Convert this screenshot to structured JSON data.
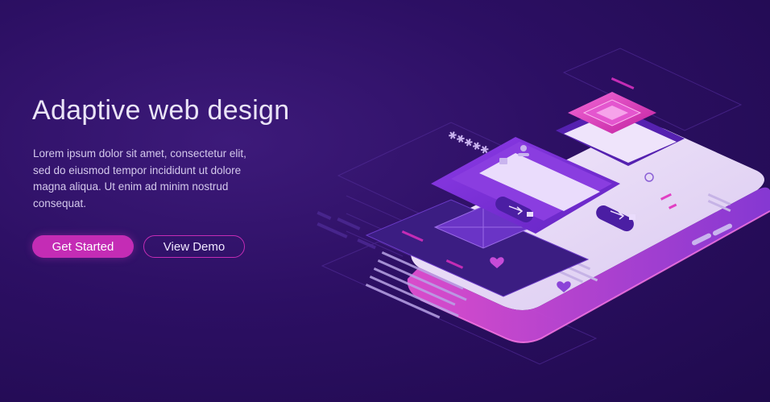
{
  "hero": {
    "title": "Adaptive web design",
    "body": "Lorem ipsum dolor sit amet, consectetur elit, sed do eiusmod tempor incididunt ut dolore magna aliqua. Ut enim ad minim nostrud consequat."
  },
  "buttons": {
    "primary_label": "Get Started",
    "secondary_label": "View Demo"
  },
  "illustration": {
    "password_mask": "✱✱✱✱✱"
  },
  "colors": {
    "background": "#2c0f63",
    "accent": "#c42cb5",
    "panel": "#7b2fd6",
    "pink_highlight": "#e040c8"
  }
}
